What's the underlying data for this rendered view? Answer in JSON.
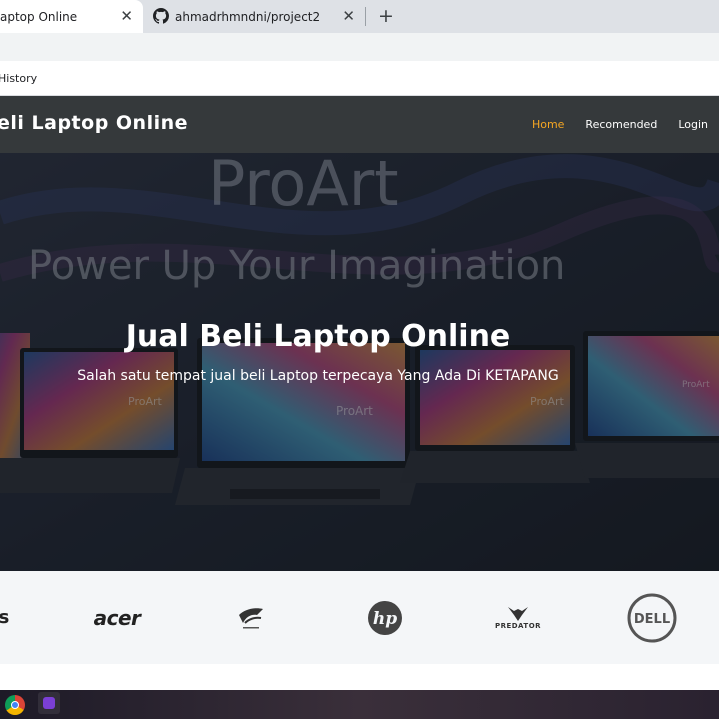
{
  "browser": {
    "tabs": [
      {
        "title": "aptop Online",
        "close": "✕"
      },
      {
        "title": "ahmadrhmndni/project2",
        "close": "✕"
      }
    ],
    "new_tab": "+",
    "bookmark": "History"
  },
  "navbar": {
    "brand": "eli Laptop Online",
    "links": [
      {
        "label": "Home",
        "active": true
      },
      {
        "label": "Recomended",
        "active": false
      },
      {
        "label": "Login",
        "active": false
      }
    ],
    "active_color": "#f5a623"
  },
  "hero": {
    "banner_brand": "ProArt",
    "banner_tagline": "Power Up Your Imagination",
    "title": "Jual Beli Laptop Online",
    "subtitle": "Salah satu tempat jual beli Laptop terpecaya Yang Ada Di KETAPANG",
    "screen_labels": [
      "ProArt",
      "ProArt",
      "ProArt",
      "ProArt"
    ]
  },
  "brands": {
    "items": [
      "s",
      "acer",
      "ROG",
      "hp",
      "PREDATOR",
      "DELL"
    ]
  },
  "taskbar": {
    "icons": [
      "chrome-icon",
      "app-icon"
    ]
  }
}
